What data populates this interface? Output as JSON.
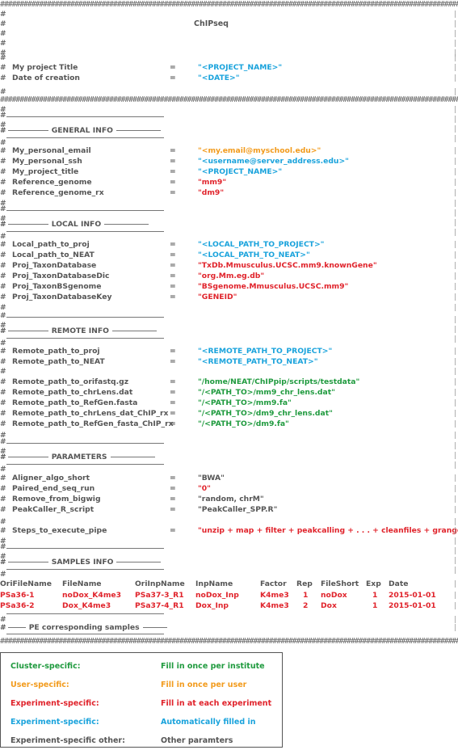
{
  "title": "ChIPseq",
  "header_lines": [
    {
      "key": "My project Title",
      "value": "\"<PROJECT_NAME>\"",
      "color": "cyan"
    },
    {
      "key": "Date of creation",
      "value": "\"<DATE>\"",
      "color": "cyan"
    }
  ],
  "sections": {
    "general": "GENERAL INFO",
    "local": "LOCAL INFO",
    "remote": "REMOTE INFO",
    "parameters": "PARAMETERS",
    "samples": "SAMPLES INFO",
    "pe": "PE corresponding samples"
  },
  "general_info": [
    {
      "key": "My_personal_email",
      "value": "\"<my.email@myschool.edu>\"",
      "color": "orange"
    },
    {
      "key": "My_personal_ssh",
      "value": "\"<username@server_address.edu>\"",
      "color": "cyan"
    },
    {
      "key": "My_project_title",
      "value": "\"<PROJECT_NAME>\"",
      "color": "cyan"
    },
    {
      "key": "Reference_genome",
      "value": "\"mm9\"",
      "color": "red"
    },
    {
      "key": "Reference_genome_rx",
      "value": "\"dm9\"",
      "color": "red"
    }
  ],
  "local_info": [
    {
      "key": "Local_path_to_proj",
      "value": "\"<LOCAL_PATH_TO_PROJECT>\"",
      "color": "cyan"
    },
    {
      "key": "Local_path_to_NEAT",
      "value": "\"<LOCAL_PATH_TO_NEAT>\"",
      "color": "cyan"
    },
    {
      "key": "Proj_TaxonDatabase",
      "value": "\"TxDb.Mmusculus.UCSC.mm9.knownGene\"",
      "color": "red"
    },
    {
      "key": "Proj_TaxonDatabaseDic",
      "value": "\"org.Mm.eg.db\"",
      "color": "red"
    },
    {
      "key": "Proj_TaxonBSgenome",
      "value": "\"BSgenome.Mmusculus.UCSC.mm9\"",
      "color": "red"
    },
    {
      "key": "Proj_TaxonDatabaseKey",
      "value": "\"GENEID\"",
      "color": "red"
    }
  ],
  "remote_info": [
    {
      "key": "Remote_path_to_proj",
      "value": "\"<REMOTE_PATH_TO_PROJECT>\"",
      "color": "cyan"
    },
    {
      "key": "Remote_path_to_NEAT",
      "value": "\"<REMOTE_PATH_TO_NEAT>\"",
      "color": "cyan"
    }
  ],
  "remote_paths": [
    {
      "key": "Remote_path_to_orifastq.gz",
      "value": "\"/home/NEAT/ChIPpip/scripts/testdata\"",
      "color": "green"
    },
    {
      "key": "Remote_path_to_chrLens.dat",
      "value": "\"/<PATH_TO>/mm9_chr_lens.dat\"",
      "color": "green"
    },
    {
      "key": "Remote_path_to_RefGen.fasta",
      "value": "\"/<PATH_TO>/mm9.fa\"",
      "color": "green"
    },
    {
      "key": "Remote_path_to_chrLens_dat_ChIP_rx",
      "value": "\"/<PATH_TO>/dm9_chr_lens.dat\"",
      "color": "green"
    },
    {
      "key": "Remote_path_to_RefGen_fasta_ChIP_rx",
      "value": "\"/<PATH_TO>/dm9.fa\"",
      "color": "green"
    }
  ],
  "parameters": [
    {
      "key": "Aligner_algo_short",
      "value": "\"BWA\"",
      "color": "gray"
    },
    {
      "key": "Paired_end_seq_run",
      "value": "\"0\"",
      "color": "red"
    },
    {
      "key": "Remove_from_bigwig",
      "value": "\"random, chrM\"",
      "color": "gray"
    },
    {
      "key": "PeakCaller_R_script",
      "value": "\"PeakCaller_SPP.R\"",
      "color": "gray"
    }
  ],
  "steps": {
    "key": "Steps_to_execute_pipe",
    "value": "\"unzip + map + filter + peakcalling + . . . + cleanfiles + granges\"",
    "color": "red"
  },
  "equals": "=",
  "samples": {
    "headers": [
      "OriFileName",
      "FileName",
      "OriInpName",
      "InpName",
      "Factor",
      "Rep",
      "FileShort",
      "Exp",
      "Date"
    ],
    "rows": [
      [
        "PSa36-1",
        "noDox_K4me3",
        "PSa37-3_R1",
        "noDox_Inp",
        "K4me3",
        "1",
        "noDox",
        "1",
        "2015-01-01"
      ],
      [
        "PSa36-2",
        "Dox_K4me3",
        "PSa37-4_R1",
        "Dox_Inp",
        "K4me3",
        "2",
        "Dox",
        "1",
        "2015-01-01"
      ]
    ]
  },
  "legend": [
    {
      "label": "Cluster-specific:",
      "desc": "Fill in once per institute",
      "color": "green"
    },
    {
      "label": "User-specific:",
      "desc": "Fill in once per user",
      "color": "orange"
    },
    {
      "label": "Experiment-specific:",
      "desc": "Fill in at each experiment",
      "color": "red"
    },
    {
      "label": "Experiment-specific:",
      "desc": "Automatically filled in",
      "color": "cyan"
    },
    {
      "label": "Experiment-specific other:",
      "desc": "Other paramters",
      "color": "gray"
    }
  ],
  "colors": {
    "green": "#1f9a3e",
    "orange": "#f29b1d",
    "red": "#e0232b",
    "cyan": "#1aa3dc",
    "gray": "#555555"
  }
}
